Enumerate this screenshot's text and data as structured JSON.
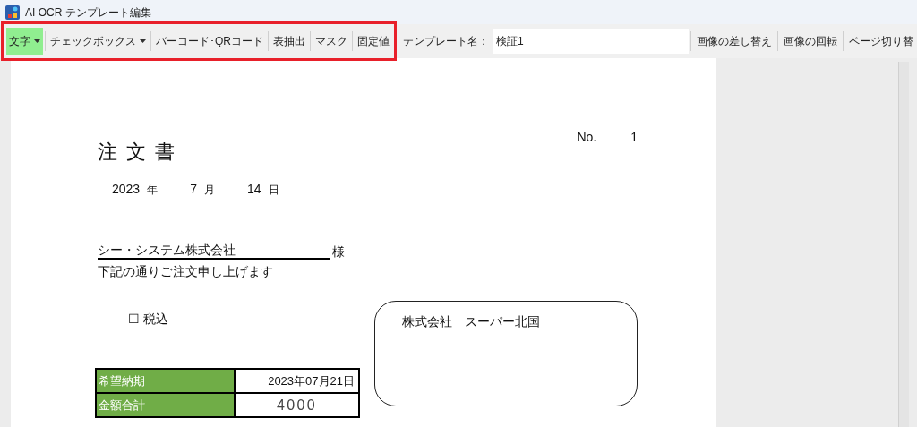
{
  "window": {
    "title": "AI OCR テンプレート編集"
  },
  "toolbar": {
    "tools": [
      {
        "label": "文字",
        "kind": "dropdown",
        "selected": true
      },
      {
        "label": "チェックボックス",
        "kind": "dropdown",
        "selected": false
      },
      {
        "label": "バーコード･QRコード",
        "kind": "button",
        "selected": false
      },
      {
        "label": "表抽出",
        "kind": "button",
        "selected": false
      },
      {
        "label": "マスク",
        "kind": "button",
        "selected": false
      },
      {
        "label": "固定値",
        "kind": "button",
        "selected": false
      }
    ],
    "template_label": "テンプレート名：",
    "template_name": "検証1",
    "actions": [
      "画像の差し替え",
      "画像の回転",
      "ページ切り替"
    ]
  },
  "document": {
    "no_label": "No.",
    "no_value": "1",
    "title": "注文書",
    "date": [
      {
        "value": "2023",
        "unit": "年"
      },
      {
        "value": "7",
        "unit": "月"
      },
      {
        "value": "14",
        "unit": "日"
      }
    ],
    "customer": "シー・システム株式会社",
    "honorific": "様",
    "greeting": "下記の通りご注文申し上げます",
    "tax_box": "☐",
    "tax_label": "税込",
    "table": [
      {
        "label": "希望納期",
        "value": "2023年07月21日"
      },
      {
        "label": "金額合計",
        "value": "4000"
      }
    ],
    "supplier": "株式会社　スーパー北国"
  }
}
